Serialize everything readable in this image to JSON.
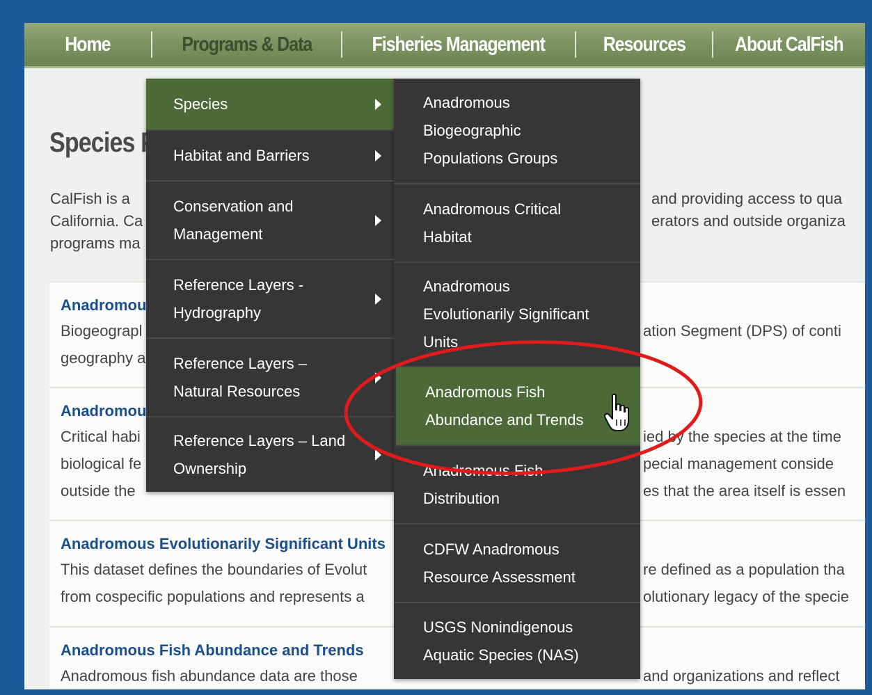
{
  "nav": {
    "items": [
      "Home",
      "Programs & Data",
      "Fisheries Management",
      "Resources",
      "About CalFish"
    ]
  },
  "page": {
    "title": "Species P",
    "intro_lines": [
      "CalFish is a",
      "California. Ca",
      "programs ma"
    ],
    "intro_right_lines": [
      "and providing access to qua",
      "erators and outside organiza",
      ""
    ]
  },
  "cards": [
    {
      "title": "Anadromou",
      "lines_left": [
        "Biogeograpl",
        "geography a"
      ],
      "lines_right": [
        "ation Segment (DPS) of conti",
        ""
      ]
    },
    {
      "title": "Anadromou",
      "lines_left": [
        "Critical habi",
        "biological fe",
        "outside the"
      ],
      "lines_right": [
        "ied by the species at the time",
        "pecial management conside",
        "es that the area itself is essen"
      ]
    },
    {
      "title": "Anadromous Evolutionarily Significant Units",
      "lines_left": [
        "This dataset defines the boundaries of Evolut",
        "from cospecific populations and represents a"
      ],
      "lines_right": [
        "re defined as a population tha",
        "olutionary legacy of the specie"
      ]
    },
    {
      "title": "Anadromous Fish Abundance and Trends",
      "lines_left": [
        "Anadromous fish abundance data are those"
      ],
      "lines_right": [
        "and organizations and reflect"
      ]
    }
  ],
  "menu1": [
    {
      "lines": [
        "Species"
      ],
      "active": true
    },
    {
      "lines": [
        "Habitat and Barriers"
      ],
      "active": false
    },
    {
      "lines": [
        "Conservation and",
        "Management"
      ],
      "active": false
    },
    {
      "lines": [
        "Reference Layers -",
        "Hydrography"
      ],
      "active": false
    },
    {
      "lines": [
        "Reference Layers –",
        "Natural Resources"
      ],
      "active": false
    },
    {
      "lines": [
        "Reference Layers – Land",
        "Ownership"
      ],
      "active": false
    }
  ],
  "menu2": [
    {
      "lines": [
        "Anadromous",
        "Biogeographic",
        "Populations Groups"
      ],
      "active": false
    },
    {
      "lines": [
        "Anadromous Critical",
        "Habitat"
      ],
      "active": false
    },
    {
      "lines": [
        "Anadromous",
        "Evolutionarily Significant",
        "Units"
      ],
      "active": false
    },
    {
      "lines": [
        "Anadromous Fish",
        "Abundance and Trends"
      ],
      "active": true
    },
    {
      "lines": [
        "Anadromous Fish",
        "Distribution"
      ],
      "active": false
    },
    {
      "lines": [
        "CDFW Anadromous",
        "Resource Assessment"
      ],
      "active": false
    },
    {
      "lines": [
        "USGS Nonindigenous",
        "Aquatic Species (NAS)"
      ],
      "active": false
    }
  ],
  "colors": {
    "frame": "#1d5a9b",
    "nav_green": "#7d9462",
    "menu_bg": "#363636",
    "menu_active": "#4c6a37",
    "highlight_ring": "#e01b1b",
    "link_blue": "#1a4f8c"
  },
  "icons": {
    "cursor": "hand-pointer-icon",
    "submenu_arrow": "chevron-right-icon"
  }
}
